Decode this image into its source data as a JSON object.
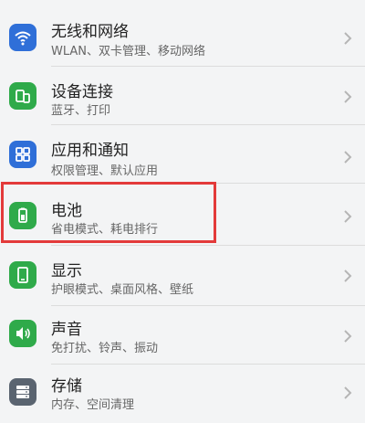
{
  "items": [
    {
      "title": "无线和网络",
      "subtitle": "WLAN、双卡管理、移动网络",
      "icon": "wifi-icon",
      "color": "#2f6fd8"
    },
    {
      "title": "设备连接",
      "subtitle": "蓝牙、打印",
      "icon": "device-connect-icon",
      "color": "#2faa4a"
    },
    {
      "title": "应用和通知",
      "subtitle": "权限管理、默认应用",
      "icon": "apps-icon",
      "color": "#2f6fd8"
    },
    {
      "title": "电池",
      "subtitle": "省电模式、耗电排行",
      "icon": "battery-icon",
      "color": "#2faa4a"
    },
    {
      "title": "显示",
      "subtitle": "护眼模式、桌面风格、壁纸",
      "icon": "display-icon",
      "color": "#2faa4a"
    },
    {
      "title": "声音",
      "subtitle": "免打扰、铃声、振动",
      "icon": "sound-icon",
      "color": "#2faa4a"
    },
    {
      "title": "存储",
      "subtitle": "内存、空间清理",
      "icon": "storage-icon",
      "color": "#5a6470"
    }
  ],
  "highlight_color": "#e33a3a"
}
